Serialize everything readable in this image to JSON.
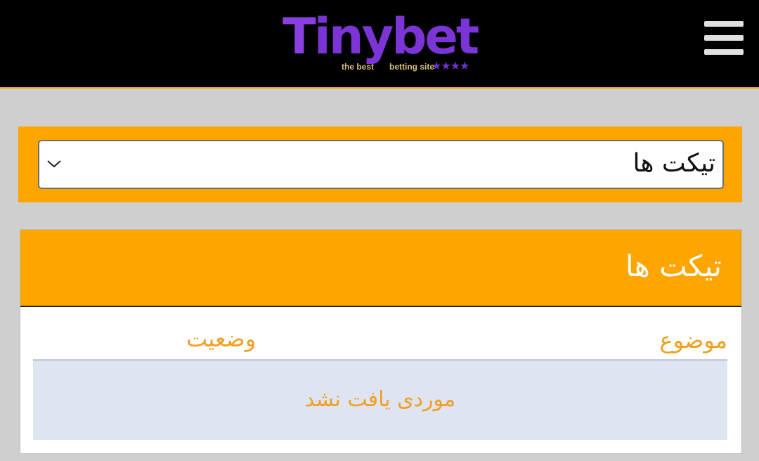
{
  "header": {
    "logo": {
      "first_letter": "T",
      "letters_inny": "iny",
      "letter_b": "b",
      "letters_et": "et",
      "tag_left": "the best",
      "tag_right": "betting site",
      "stars": "★★★★"
    },
    "menu_icon": "hamburger-menu-icon"
  },
  "filter": {
    "selected_value": "تیکت ها",
    "chevron_icon": "chevron-down-icon"
  },
  "tickets": {
    "title": "تیکت ها",
    "columns": {
      "subject": "موضوع",
      "status": "وضعیت"
    },
    "empty_message": "موردی یافت نشد"
  },
  "colors": {
    "accent": "#ffa500",
    "header_bg": "#000000",
    "page_bg": "#cfcfcf",
    "column_text": "#f0a020",
    "empty_row_bg": "#dfe4f2",
    "logo_purple": "#7b35d6",
    "logo_gold": "#c9a13b"
  }
}
